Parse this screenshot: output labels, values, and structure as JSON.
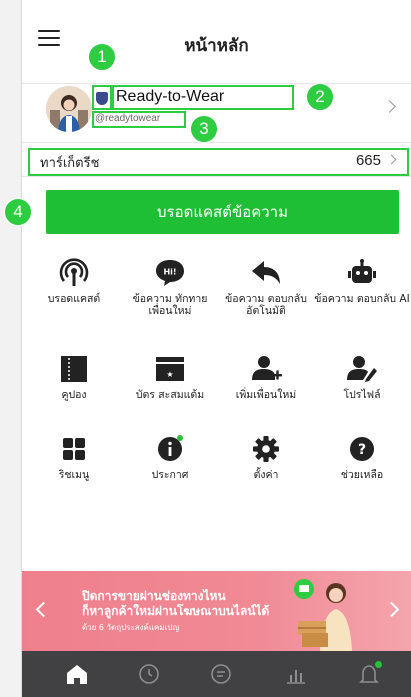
{
  "header": {
    "title": "หน้าหลัก",
    "menu_icon": "hamburger-menu-icon"
  },
  "profile": {
    "name": "Ready-to-Wear",
    "handle": "@readytowear",
    "badge_icon": "shield-badge-icon"
  },
  "friends": {
    "label": "ทาร์เก็ตรีช",
    "count": "665"
  },
  "broadcast_button": {
    "label": "บรอดแคสต์ข้อความ",
    "color": "#1fbf35"
  },
  "grid": {
    "items": [
      {
        "icon": "broadcast-icon",
        "label": "บรอดแคสต์"
      },
      {
        "icon": "greeting-message-icon",
        "label": "ข้อความ ทักทาย เพื่อนใหม่"
      },
      {
        "icon": "auto-reply-icon",
        "label": "ข้อความ ตอบกลับ อัตโนมัติ"
      },
      {
        "icon": "ai-reply-icon",
        "label": "ข้อความ ตอบกลับ AI"
      },
      {
        "icon": "coupon-icon",
        "label": "คูปอง"
      },
      {
        "icon": "reward-card-icon",
        "label": "บัตร สะสมแต้ม"
      },
      {
        "icon": "add-friend-icon",
        "label": "เพิ่มเพื่อนใหม่"
      },
      {
        "icon": "profile-icon",
        "label": "โปรไฟล์"
      },
      {
        "icon": "rich-menu-icon",
        "label": "ริชเมนู"
      },
      {
        "icon": "announcement-icon",
        "label": "ประกาศ"
      },
      {
        "icon": "settings-icon",
        "label": "ตั้งค่า"
      },
      {
        "icon": "help-icon",
        "label": "ช่วยเหลือ"
      }
    ]
  },
  "banner": {
    "line1": "ปิดการขายผ่านช่องทางไหน",
    "line2": "ก็หาลูกค้าใหม่ผ่านโฆษณาบนไลน์ได้",
    "sub": "ด้วย 6 วัตถุประสงค์แคมเปญ",
    "bg_color": "#ef7f8c"
  },
  "bottom_nav": {
    "items": [
      "home-icon",
      "clock-icon",
      "chat-icon",
      "chart-icon",
      "notification-bell-icon"
    ],
    "active": "home-icon"
  },
  "annotations": [
    "1",
    "2",
    "3",
    "4"
  ],
  "accent_color": "#2ecc40"
}
